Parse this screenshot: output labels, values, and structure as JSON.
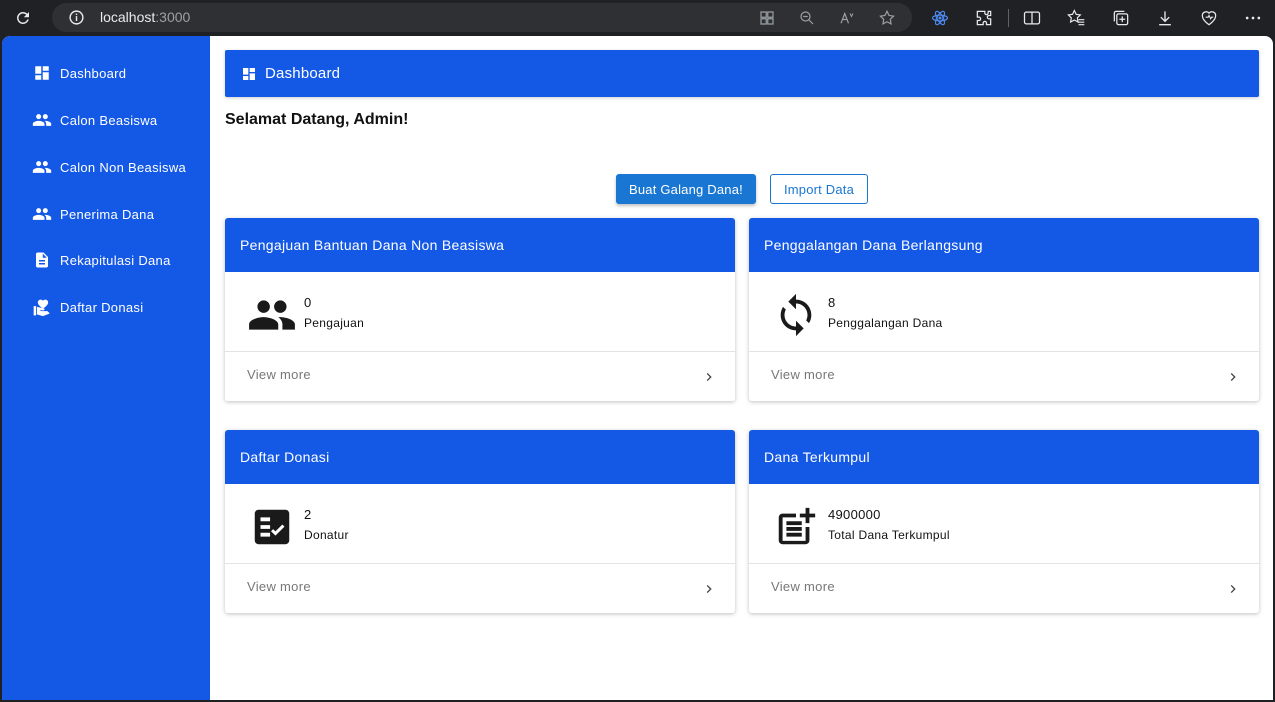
{
  "browser": {
    "url_host": "localhost",
    "url_port": ":3000"
  },
  "sidebar": {
    "items": [
      {
        "label": "Dashboard",
        "icon": "dashboard-icon"
      },
      {
        "label": "Calon Beasiswa",
        "icon": "people-icon"
      },
      {
        "label": "Calon Non Beasiswa",
        "icon": "people-icon"
      },
      {
        "label": "Penerima Dana",
        "icon": "people-icon"
      },
      {
        "label": "Rekapitulasi Dana",
        "icon": "document-icon"
      },
      {
        "label": "Daftar Donasi",
        "icon": "volunteer-heart-icon"
      }
    ]
  },
  "header": {
    "title": "Dashboard",
    "icon": "dashboard-icon"
  },
  "welcome": "Selamat Datang, Admin!",
  "actions": {
    "primary_label": "Buat Galang Dana!",
    "secondary_label": "Import Data"
  },
  "cards": [
    {
      "title": "Pengajuan Bantuan Dana Non Beasiswa",
      "value": "0",
      "unit": "Pengajuan",
      "footer": "View more",
      "icon": "people-icon"
    },
    {
      "title": "Penggalangan Dana Berlangsung",
      "value": "8",
      "unit": "Penggalangan Dana",
      "footer": "View more",
      "icon": "sync-icon"
    },
    {
      "title": "Daftar Donasi",
      "value": "2",
      "unit": "Donatur",
      "footer": "View more",
      "icon": "checklist-icon"
    },
    {
      "title": "Dana Terkumpul",
      "value": "4900000",
      "unit": "Total Dana Terkumpul",
      "footer": "View more",
      "icon": "post-add-icon"
    }
  ],
  "colors": {
    "primary": "#1458e6",
    "button": "#1976d2"
  }
}
